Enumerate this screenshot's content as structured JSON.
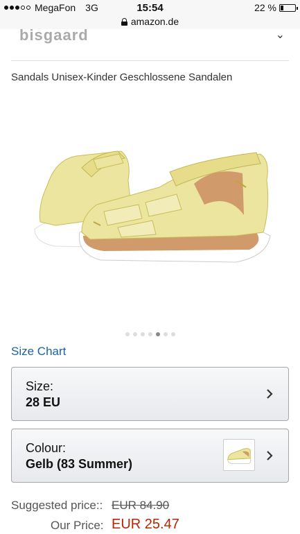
{
  "status_bar": {
    "carrier": "MegaFon",
    "network": "3G",
    "time": "15:54",
    "battery_text": "22 %",
    "battery_level": 0.22,
    "signal_strength": 3,
    "signal_max": 5
  },
  "browser": {
    "url": "amazon.de"
  },
  "brand": {
    "logo_text": "bisgaard"
  },
  "product": {
    "title": "Sandals Unisex-Kinder Geschlossene Sandalen",
    "carousel": {
      "count": 7,
      "active_index": 4
    }
  },
  "size_chart_link": "Size Chart",
  "size_selector": {
    "label": "Size:",
    "value": "28 EU"
  },
  "colour_selector": {
    "label": "Colour:",
    "value": "Gelb (83 Summer)"
  },
  "pricing": {
    "suggested_label": "Suggested price::",
    "suggested_value": "EUR 84.90",
    "our_label": "Our Price:",
    "our_value": "EUR 25.47"
  },
  "colors": {
    "link": "#1a62a6",
    "price": "#b12704",
    "sandal": "#e9e39a",
    "sole": "#ffffff",
    "lining": "#d09a6a"
  }
}
